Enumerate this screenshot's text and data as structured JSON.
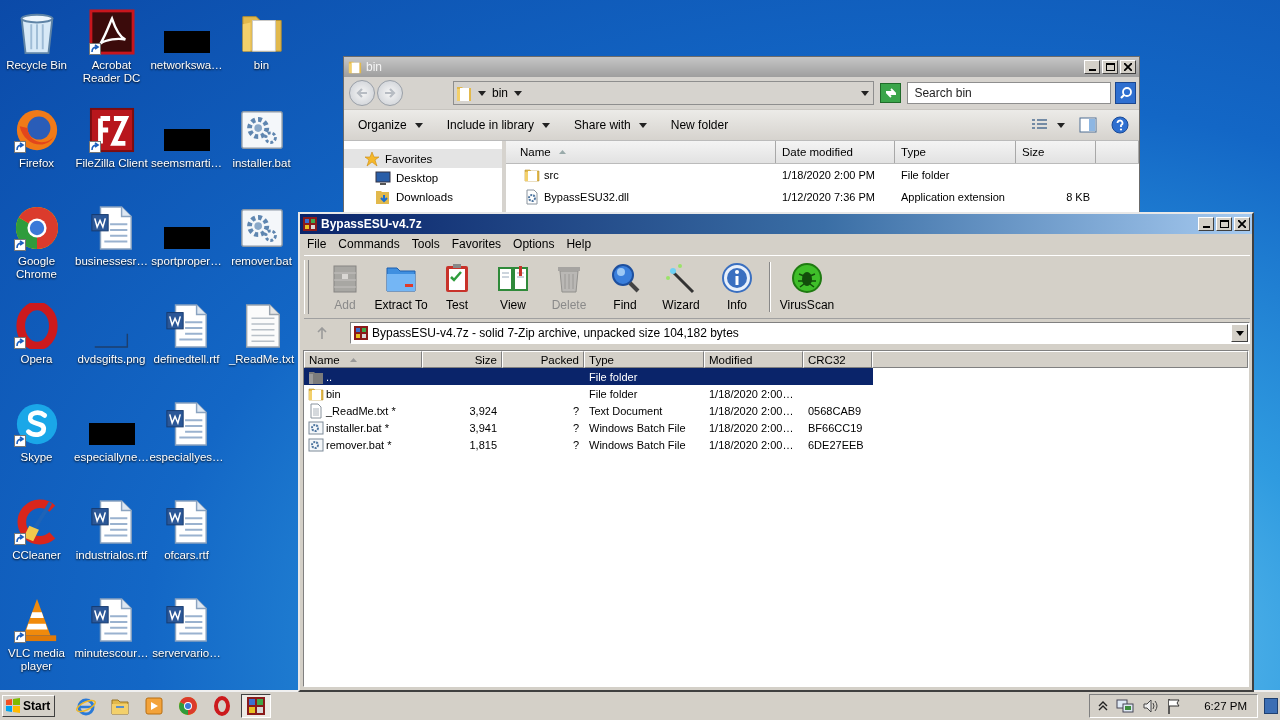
{
  "desktop": {
    "icons": [
      {
        "label": "Recycle Bin",
        "kind": "recycle",
        "shortcut": false
      },
      {
        "label": "Firefox",
        "kind": "firefox",
        "shortcut": true
      },
      {
        "label": "Google Chrome",
        "kind": "chrome",
        "shortcut": true
      },
      {
        "label": "Opera",
        "kind": "opera",
        "shortcut": true
      },
      {
        "label": "Skype",
        "kind": "skype",
        "shortcut": true
      },
      {
        "label": "CCleaner",
        "kind": "ccleaner",
        "shortcut": true
      },
      {
        "label": "VLC media player",
        "kind": "vlc",
        "shortcut": true
      },
      {
        "label": "Acrobat Reader DC",
        "kind": "acrobat",
        "shortcut": true
      },
      {
        "label": "FileZilla Client",
        "kind": "filezilla",
        "shortcut": true
      },
      {
        "label": "businessesr…",
        "kind": "word",
        "shortcut": false
      },
      {
        "label": "dvdsgifts.png",
        "kind": "blank",
        "shortcut": false
      },
      {
        "label": "especiallyne…",
        "kind": "redacted",
        "shortcut": false
      },
      {
        "label": "industrialos.rtf",
        "kind": "word",
        "shortcut": false
      },
      {
        "label": "minutescour…",
        "kind": "word",
        "shortcut": false
      },
      {
        "label": "networkswa…",
        "kind": "redacted",
        "shortcut": false
      },
      {
        "label": "seemsmarti…",
        "kind": "redacted",
        "shortcut": false
      },
      {
        "label": "sportproper…",
        "kind": "redacted",
        "shortcut": false
      },
      {
        "label": "definedtell.rtf",
        "kind": "word",
        "shortcut": false
      },
      {
        "label": "especiallyes…",
        "kind": "word",
        "shortcut": false
      },
      {
        "label": "ofcars.rtf",
        "kind": "word",
        "shortcut": false
      },
      {
        "label": "servervario…",
        "kind": "word",
        "shortcut": false
      },
      {
        "label": "bin",
        "kind": "folder",
        "shortcut": false
      },
      {
        "label": "installer.bat",
        "kind": "gear",
        "shortcut": false
      },
      {
        "label": "remover.bat",
        "kind": "gear",
        "shortcut": false
      },
      {
        "label": "_ReadMe.txt",
        "kind": "text",
        "shortcut": false
      }
    ]
  },
  "explorer": {
    "title": "bin",
    "breadcrumb": "bin",
    "search": {
      "placeholder": "Search bin"
    },
    "toolbar": [
      {
        "label": "Organize",
        "menu": true
      },
      {
        "label": "Include in library",
        "menu": true
      },
      {
        "label": "Share with",
        "menu": true
      },
      {
        "label": "New folder",
        "menu": false
      }
    ],
    "nav": [
      {
        "label": "Favorites",
        "kind": "star",
        "selected": true
      },
      {
        "label": "Desktop",
        "kind": "desktop",
        "selected": false
      },
      {
        "label": "Downloads",
        "kind": "downloads",
        "selected": false
      }
    ],
    "columns": [
      {
        "label": "Name",
        "sorted": true
      },
      {
        "label": "Date modified",
        "sorted": false
      },
      {
        "label": "Type",
        "sorted": false
      },
      {
        "label": "Size",
        "sorted": false
      }
    ],
    "rows": [
      {
        "name": "src",
        "kind": "folder",
        "date": "1/18/2020 2:00 PM",
        "type": "File folder"
      },
      {
        "name": "BypassESU32.dll",
        "kind": "dll",
        "date": "1/12/2020 7:36 PM",
        "type": "Application extension",
        "size": "8 KB"
      }
    ]
  },
  "archiver": {
    "title": "BypassESU-v4.7z",
    "menu": [
      "File",
      "Commands",
      "Tools",
      "Favorites",
      "Options",
      "Help"
    ],
    "tools": [
      {
        "label": "Add",
        "kind": "add",
        "disabled": true
      },
      {
        "label": "Extract To",
        "kind": "extract",
        "disabled": false
      },
      {
        "label": "Test",
        "kind": "test",
        "disabled": false
      },
      {
        "label": "View",
        "kind": "view",
        "disabled": false
      },
      {
        "label": "Delete",
        "kind": "delete",
        "disabled": true
      },
      {
        "label": "Find",
        "kind": "find",
        "disabled": false
      },
      {
        "label": "Wizard",
        "kind": "wizard",
        "disabled": false
      },
      {
        "label": "Info",
        "kind": "info",
        "disabled": false
      },
      {
        "label": "VirusScan",
        "kind": "virus",
        "disabled": false
      }
    ],
    "path": "BypassESU-v4.7z - solid 7-Zip archive, unpacked size 104,182 bytes",
    "columns": [
      {
        "label": "Name",
        "sorted": true
      },
      {
        "label": "Size",
        "sorted": false
      },
      {
        "label": "Packed",
        "sorted": false
      },
      {
        "label": "Type",
        "sorted": false
      },
      {
        "label": "Modified",
        "sorted": false
      },
      {
        "label": "CRC32",
        "sorted": false
      }
    ],
    "rows": [
      {
        "name": "..",
        "kind": "up",
        "type": "File folder",
        "selected": true
      },
      {
        "name": "bin",
        "kind": "folder",
        "type": "File folder",
        "modified": "1/18/2020 2:00…",
        "selected": false
      },
      {
        "name": "_ReadMe.txt *",
        "kind": "text",
        "size": "3,924",
        "packed": "?",
        "type": "Text Document",
        "modified": "1/18/2020 2:00…",
        "crc": "0568CAB9",
        "selected": false
      },
      {
        "name": "installer.bat *",
        "kind": "gear",
        "size": "3,941",
        "packed": "?",
        "type": "Windows Batch File",
        "modified": "1/18/2020 2:00…",
        "crc": "BF66CC19",
        "selected": false
      },
      {
        "name": "remover.bat *",
        "kind": "gear",
        "size": "1,815",
        "packed": "?",
        "type": "Windows Batch File",
        "modified": "1/18/2020 2:00…",
        "crc": "6DE27EEB",
        "selected": false
      }
    ]
  },
  "taskbar": {
    "start": "Start",
    "apps": [
      {
        "kind": "ie",
        "active": false
      },
      {
        "kind": "explorer",
        "active": false
      },
      {
        "kind": "media",
        "active": false
      },
      {
        "kind": "chrome",
        "active": false
      },
      {
        "kind": "opera",
        "active": false
      },
      {
        "kind": "archiver",
        "active": true
      }
    ],
    "clock": "6:27 PM"
  }
}
